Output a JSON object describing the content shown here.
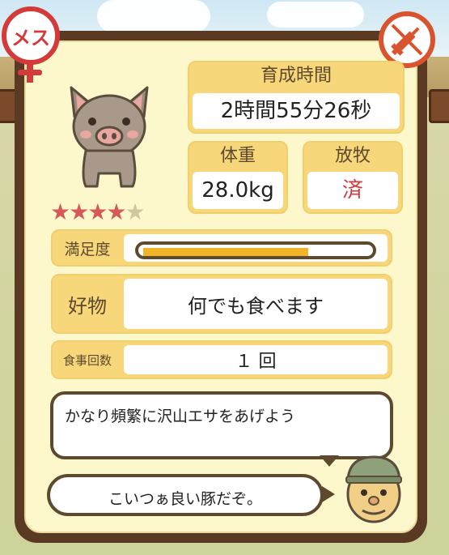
{
  "gender_badge": {
    "label": "メス",
    "color": "#d33a3a"
  },
  "vaccine_badge": {
    "icon": "syringe-prohibited-icon",
    "color": "#d9532f"
  },
  "pig": {
    "icon": "pig-icon",
    "rating": 4,
    "max_rating": 5
  },
  "stats": {
    "breeding_time_label": "育成時間",
    "breeding_time_value": "2時間55分26秒",
    "weight_label": "体重",
    "weight_value": "28.0kg",
    "grazing_label": "放牧",
    "grazing_value": "済"
  },
  "rows": {
    "satisfaction_label": "満足度",
    "satisfaction_level": 0.73,
    "favorite_label": "好物",
    "favorite_value": "何でも食べます",
    "meals_label": "食事回数",
    "meals_value": "１ 回"
  },
  "bubbles": {
    "hint": "かなり頻繁に沢山エサをあげよう",
    "comment": "こいつぁ良い豚だぞ。"
  },
  "colors": {
    "panel_border": "#5b3a24",
    "panel_bg": "#fdf7cc",
    "label_bg": "#f7d77a",
    "bar_fill": "#f0b42a",
    "grazing_value_color": "#d33a3a"
  }
}
